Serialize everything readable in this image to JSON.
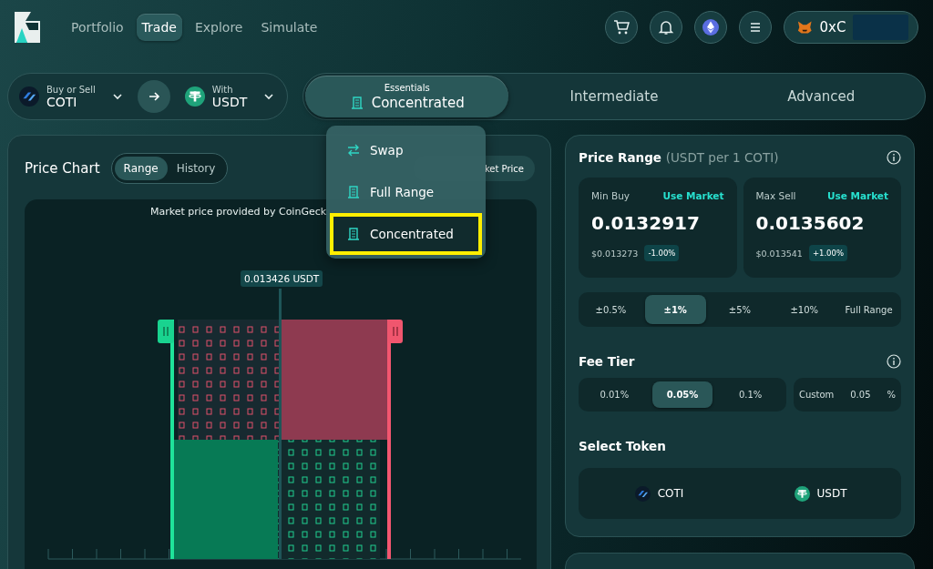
{
  "nav": {
    "links": [
      {
        "label": "Portfolio",
        "selected": false
      },
      {
        "label": "Trade",
        "selected": true
      },
      {
        "label": "Explore",
        "selected": false
      },
      {
        "label": "Simulate",
        "selected": false
      }
    ],
    "wallet": {
      "address": "0xC"
    }
  },
  "pair": {
    "from": {
      "caption": "Buy or Sell",
      "token": "COTI",
      "kind": "coti"
    },
    "to": {
      "caption": "With",
      "token": "USDT",
      "kind": "usdt"
    }
  },
  "strategies": [
    {
      "group": "Essentials",
      "label": "Concentrated",
      "selected": true
    },
    {
      "label": "Intermediate",
      "selected": false
    },
    {
      "label": "Advanced",
      "selected": false
    }
  ],
  "strategy_menu": [
    {
      "kind": "swap",
      "label": "Swap",
      "highlighted": false
    },
    {
      "kind": "range",
      "label": "Full Range",
      "highlighted": false
    },
    {
      "kind": "range",
      "label": "Concentrated",
      "highlighted": true
    }
  ],
  "price_chart": {
    "title": "Price Chart",
    "views": [
      {
        "label": "Range",
        "selected": true
      },
      {
        "label": "History",
        "selected": false
      }
    ],
    "market_button": "ket Price",
    "source_note": "Market price provided by CoinGeck",
    "current_price": "0.013426 USDT"
  },
  "price_range": {
    "title": "Price Range",
    "unit": "(USDT per 1 COTI)",
    "bounds": [
      {
        "label": "Min Buy",
        "action": "Use Market",
        "value": "0.0132917",
        "usd": "$0.013273",
        "change": "-1.00%"
      },
      {
        "label": "Max Sell",
        "action": "Use Market",
        "value": "0.0135602",
        "usd": "$0.013541",
        "change": "+1.00%"
      }
    ],
    "presets": [
      {
        "label": "±0.5%",
        "selected": false
      },
      {
        "label": "±1%",
        "selected": true
      },
      {
        "label": "±5%",
        "selected": false
      },
      {
        "label": "±10%",
        "selected": false
      },
      {
        "label": "Full Range",
        "selected": false
      }
    ]
  },
  "fee_tier": {
    "title": "Fee Tier",
    "options": [
      {
        "label": "0.01%",
        "selected": false
      },
      {
        "label": "0.05%",
        "selected": true
      },
      {
        "label": "0.1%",
        "selected": false
      }
    ],
    "custom": {
      "label": "Custom",
      "value": "0.05",
      "unit": "%"
    }
  },
  "select_token": {
    "title": "Select Token",
    "tokens": [
      {
        "symbol": "COTI",
        "kind": "coti"
      },
      {
        "symbol": "USDT",
        "kind": "usdt"
      }
    ]
  }
}
